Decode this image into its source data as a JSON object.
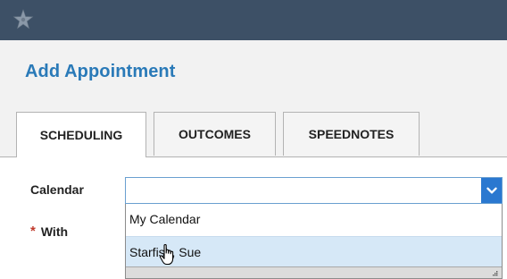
{
  "header": {
    "logo_icon": "starfish-logo-icon",
    "bar_color": "#3d5066"
  },
  "page": {
    "title": "Add Appointment",
    "title_color": "#2a7ab8"
  },
  "tabs": [
    {
      "label": "SCHEDULING",
      "active": true
    },
    {
      "label": "OUTCOMES",
      "active": false
    },
    {
      "label": "SPEEDNOTES",
      "active": false
    }
  ],
  "form": {
    "calendar_label": "Calendar",
    "calendar_value": "",
    "with_label": "With",
    "required_mark": "*"
  },
  "dropdown": {
    "options": [
      {
        "label": "My Calendar",
        "highlighted": false
      },
      {
        "label": "Starfish, Sue",
        "highlighted": true
      }
    ],
    "arrow_icon": "chevron-down-icon",
    "accent": "#2a78d0"
  }
}
